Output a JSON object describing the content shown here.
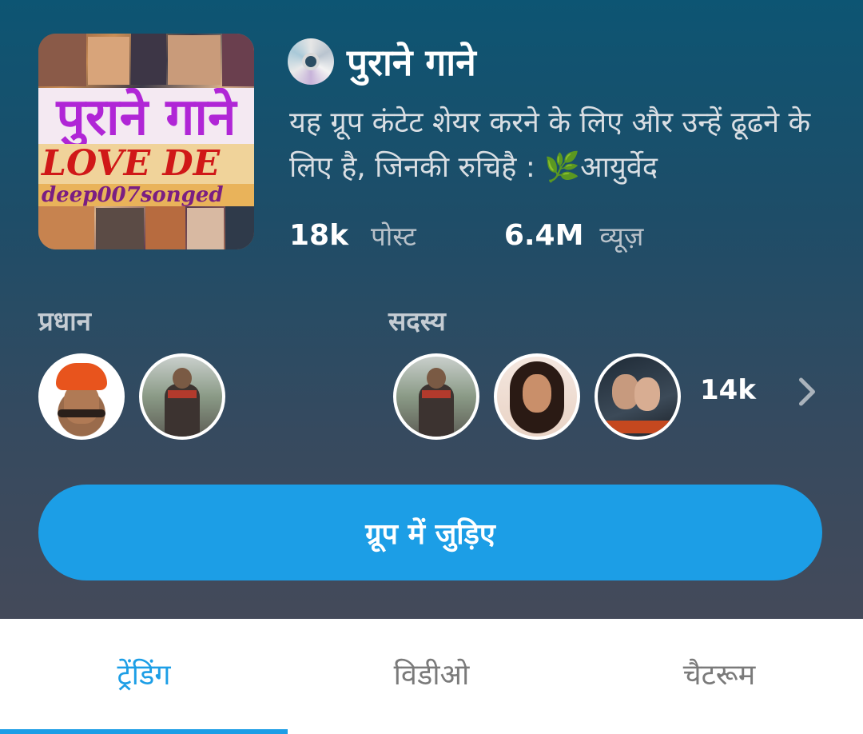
{
  "group": {
    "title": "पुराने गाने",
    "title_icon": "disc-icon",
    "description": "यह ग्रूप कंटेट शेयर करने के लिए और उन्हें ढूढने के लिए है, जिनकी रुचिहै : 🌿आयुर्वेद",
    "cover": {
      "headline": "पुराने गाने",
      "line2": "LOVE DE",
      "line3": "deep007songed"
    }
  },
  "stats": {
    "posts_value": "18k",
    "posts_label": "पोस्ट",
    "views_value": "6.4M",
    "views_label": "व्यूज़"
  },
  "admins": {
    "label": "प्रधान"
  },
  "members": {
    "label": "सदस्य",
    "count": "14k"
  },
  "join_button": {
    "label": "ग्रूप में जुड़िए",
    "color": "#1c9ee6"
  },
  "tabs": [
    {
      "label": "ट्रेंडिंग",
      "active": true
    },
    {
      "label": "विडीओ",
      "active": false
    },
    {
      "label": "चैटरूम",
      "active": false
    }
  ]
}
